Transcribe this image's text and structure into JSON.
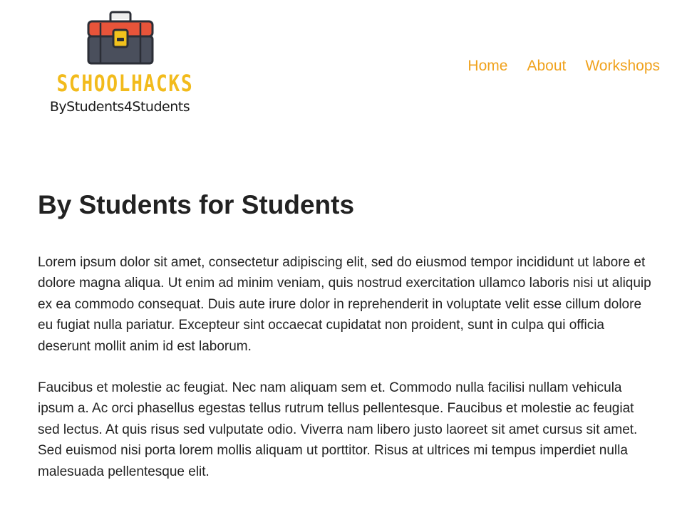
{
  "header": {
    "logo": {
      "title": "SCHOOLHACKS",
      "subtitle": "ByStudents4Students"
    },
    "nav": [
      {
        "label": "Home"
      },
      {
        "label": "About"
      },
      {
        "label": "Workshops"
      }
    ]
  },
  "main": {
    "title": "By Students for Students",
    "paragraphs": [
      "Lorem ipsum dolor sit amet, consectetur adipiscing elit, sed do eiusmod tempor incididunt ut labore et dolore magna aliqua. Ut enim ad minim veniam, quis nostrud exercitation ullamco laboris nisi ut aliquip ex ea commodo consequat. Duis aute irure dolor in reprehenderit in voluptate velit esse cillum dolore eu fugiat nulla pariatur. Excepteur sint occaecat cupidatat non proident, sunt in culpa qui officia deserunt mollit anim id est laborum.",
      "Faucibus et molestie ac feugiat. Nec nam aliquam sem et. Commodo nulla facilisi nullam vehicula ipsum a. Ac orci phasellus egestas tellus rutrum tellus pellentesque. Faucibus et molestie ac feugiat sed lectus. At quis risus sed vulputate odio. Viverra nam libero justo laoreet sit amet cursus sit amet. Sed euismod nisi porta lorem mollis aliquam ut porttitor. Risus at ultrices mi tempus imperdiet nulla malesuada pellentesque elit."
    ]
  },
  "colors": {
    "accent": "#F0A21D",
    "logo_yellow": "#F2BB1C",
    "toolbox_red": "#E8543A",
    "toolbox_dark": "#4A4F5C",
    "text": "#222222"
  },
  "icons": {
    "logo_icon": "toolbox-icon"
  }
}
